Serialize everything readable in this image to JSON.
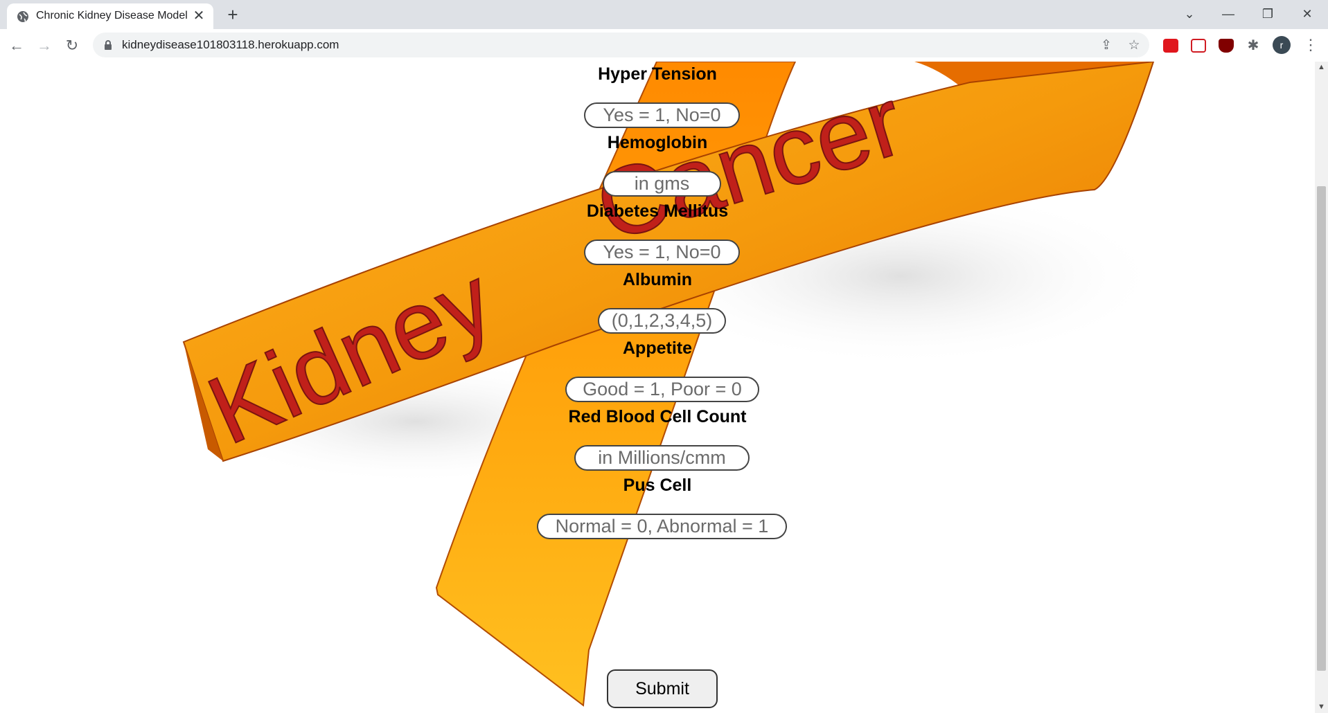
{
  "browser": {
    "tab_title": "Chronic Kidney Disease Model",
    "url": "kidneydisease101803118.herokuapp.com",
    "avatar_letter": "r"
  },
  "ribbon": {
    "text_kidney": "Kidney",
    "text_cancer": "Cancer",
    "color_ribbon": "#f7a21b",
    "color_text": "#c0201a"
  },
  "form": {
    "fields": [
      {
        "label": "Hyper Tension",
        "placeholder": "Yes = 1, No=0"
      },
      {
        "label": "Hemoglobin",
        "placeholder": "in gms"
      },
      {
        "label": "Diabetes Mellitus",
        "placeholder": "Yes = 1, No=0"
      },
      {
        "label": "Albumin",
        "placeholder": "(0,1,2,3,4,5)"
      },
      {
        "label": "Appetite",
        "placeholder": "Good = 1, Poor = 0"
      },
      {
        "label": "Red Blood Cell Count",
        "placeholder": "in Millions/cmm"
      },
      {
        "label": "Pus Cell",
        "placeholder": "Normal = 0, Abnormal = 1"
      }
    ],
    "submit_label": "Submit"
  }
}
